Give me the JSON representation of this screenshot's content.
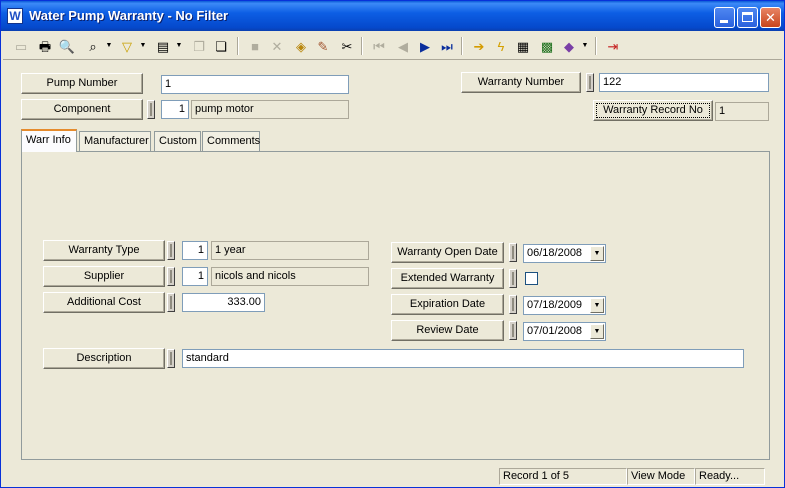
{
  "window": {
    "title": "Water Pump Warranty - No Filter",
    "icon_letter": "W",
    "minimize_icon": "minimize-icon",
    "maximize_icon": "maximize-icon",
    "close_glyph": "✕"
  },
  "toolbar": {
    "icons": [
      "new-icon",
      "print-icon",
      "print-preview-icon",
      "find-icon",
      "filter-icon",
      "report-icon",
      "copy-record-icon",
      "paste-record-icon",
      "save-icon",
      "delete-icon",
      "attach-icon",
      "edit-icon",
      "cut-icon",
      "first-record-icon",
      "previous-record-icon",
      "next-record-icon",
      "last-record-icon",
      "goto-icon",
      "run-icon",
      "form-view-icon",
      "grid-view-icon",
      "library-icon",
      "exit-icon"
    ]
  },
  "header": {
    "pump_number_label": "Pump Number",
    "pump_number_value": "1",
    "component_label": "Component",
    "component_code": "1",
    "component_name": "pump motor",
    "warranty_number_label": "Warranty Number",
    "warranty_number_value": "122",
    "warranty_record_no_label": "Warranty Record No",
    "warranty_record_no_value": "1"
  },
  "tabs": [
    {
      "label": "Warr Info"
    },
    {
      "label": "Manufacturer"
    },
    {
      "label": "Custom"
    },
    {
      "label": "Comments"
    }
  ],
  "warr_info": {
    "warranty_type_label": "Warranty Type",
    "warranty_type_code": "1",
    "warranty_type_name": "1 year",
    "supplier_label": "Supplier",
    "supplier_code": "1",
    "supplier_name": "nicols and nicols",
    "additional_cost_label": "Additional Cost",
    "additional_cost_value": "333.00",
    "warranty_open_date_label": "Warranty Open Date",
    "warranty_open_date_value": "06/18/2008",
    "extended_warranty_label": "Extended Warranty",
    "extended_warranty_checked": false,
    "expiration_date_label": "Expiration Date",
    "expiration_date_value": "07/18/2009",
    "review_date_label": "Review Date",
    "review_date_value": "07/01/2008",
    "description_label": "Description",
    "description_value": "standard"
  },
  "status": {
    "record": "Record 1 of 5",
    "mode": "View Mode",
    "state": "Ready..."
  }
}
